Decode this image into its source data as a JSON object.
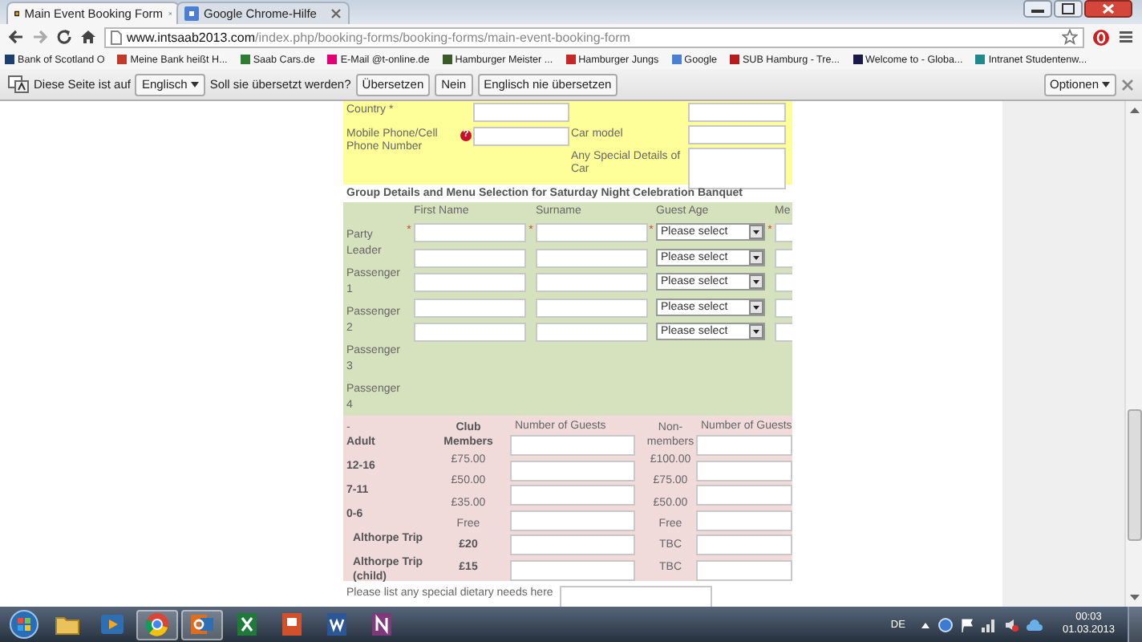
{
  "browser": {
    "tabs": [
      {
        "title": "Main Event Booking Form",
        "selected": true
      },
      {
        "title": "Google Chrome-Hilfe",
        "selected": false
      }
    ],
    "address": {
      "host": "www.intsaab2013.com",
      "path": "/index.php/booking-forms/booking-forms/main-event-booking-form"
    },
    "bookmarks": [
      {
        "label": "Bank of Scotland O",
        "color": "#1d3f6e"
      },
      {
        "label": "Meine Bank heißt H...",
        "color": "#c0392b"
      },
      {
        "label": "Saab Cars.de",
        "color": "#2e7d32"
      },
      {
        "label": "E-Mail @t-online.de",
        "color": "#e20074"
      },
      {
        "label": "Hamburger Meister ...",
        "color": "#3a5a2a"
      },
      {
        "label": "Hamburger Jungs",
        "color": "#c62828"
      },
      {
        "label": "Google",
        "color": "#4a7fd4"
      },
      {
        "label": "SUB Hamburg - Tre...",
        "color": "#b71c1c"
      },
      {
        "label": "Welcome to - Globa...",
        "color": "#1a1a4a"
      },
      {
        "label": "Intranet Studentenw...",
        "color": "#1e8a8a"
      }
    ]
  },
  "translate_bar": {
    "text_before": "Diese Seite ist auf",
    "language": "Englisch",
    "question": "Soll sie übersetzt werden?",
    "buttons": [
      "Übersetzen",
      "Nein",
      "Englisch nie übersetzen"
    ],
    "options": "Optionen"
  },
  "vehicle_section": {
    "left_fields": [
      {
        "label": "Country *"
      },
      {
        "label": "Mobile Phone/Cell Phone Number",
        "help": "?"
      }
    ],
    "right_fields": [
      {
        "kind": "input"
      },
      {
        "label": "Car model",
        "kind": "input"
      },
      {
        "label": "Any Special Details of Car",
        "kind": "textarea"
      }
    ]
  },
  "group_section": {
    "title": "Group Details and Menu Selection for Saturday Night Celebration Banquet",
    "columns": [
      "First Name",
      "Surname",
      "Guest Age",
      "Me"
    ],
    "people": [
      {
        "label": "Party Leader",
        "marks": [
          "*",
          "*",
          "*",
          "*"
        ],
        "age": "Please select"
      },
      {
        "label": "Passenger 1",
        "age": "Please select"
      },
      {
        "label": "Passenger 2",
        "age": "Please select"
      },
      {
        "label": "Passenger 3",
        "age": "Please select"
      },
      {
        "label": "Passenger 4",
        "age": "Please select"
      }
    ]
  },
  "pricing": {
    "corner": "-",
    "club_heading": "Club Members",
    "guests_heading_1": "Number of Guests",
    "nonmember_heading": "Non-members",
    "guests_heading_2": "Number of Guests",
    "row_labels": [
      {
        "text": "Adult",
        "kind": "age"
      },
      {
        "text": "12-16",
        "kind": "age"
      },
      {
        "text": "7-11",
        "kind": "age"
      },
      {
        "text": "0-6",
        "kind": "age"
      },
      {
        "text": "Althorpe Trip",
        "kind": "trip"
      },
      {
        "text": "Althorpe Trip (child)",
        "kind": "trip"
      }
    ],
    "club_prices": [
      {
        "text": "£75.00",
        "emphasis": false
      },
      {
        "text": "£50.00",
        "emphasis": false
      },
      {
        "text": "£35.00",
        "emphasis": false
      },
      {
        "text": "Free",
        "emphasis": false
      },
      {
        "text": "£20",
        "emphasis": true
      },
      {
        "text": "£15",
        "emphasis": true
      }
    ],
    "nonmember_prices": [
      "£100.00",
      "£75.00",
      "£50.00",
      "Free",
      "TBC",
      "TBC"
    ]
  },
  "dietary": {
    "label": "Please list any special dietary needs here"
  },
  "taskbar": {
    "apps": [
      {
        "kind": "folder",
        "running": false
      },
      {
        "kind": "media",
        "running": false
      },
      {
        "kind": "browser",
        "running": true
      },
      {
        "kind": "mail",
        "running": true
      },
      {
        "kind": "sheet",
        "running": false
      },
      {
        "kind": "slides",
        "running": false
      },
      {
        "kind": "doc",
        "running": false
      },
      {
        "kind": "notes",
        "running": false
      }
    ],
    "language": "DE",
    "time": "00:03",
    "date": "01.03.2013"
  }
}
